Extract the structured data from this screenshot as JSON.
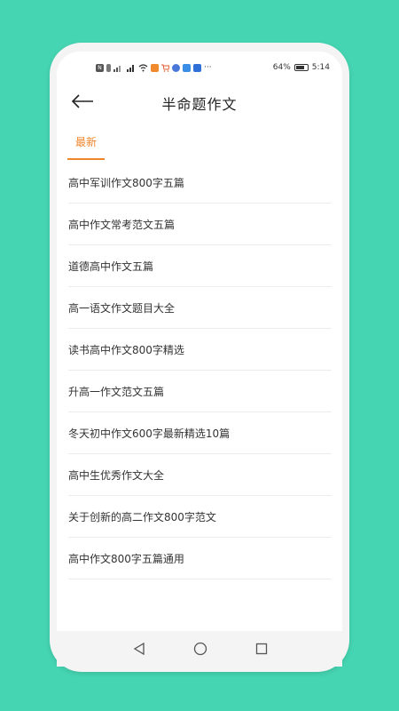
{
  "status_bar": {
    "battery": "64%",
    "battery_level": 0.64,
    "time": "5:14",
    "icons": [
      "nfc-icon",
      "sim-icon",
      "signal-icon",
      "signal-4g-icon",
      "wifi-icon",
      "app-icon-orange",
      "cart-icon",
      "app-icon-blue",
      "app-icon-search",
      "app-icon-bubble",
      "more-icon"
    ]
  },
  "header": {
    "title": "半命题作文"
  },
  "tabs": [
    {
      "label": "最新",
      "active": true
    }
  ],
  "list": [
    {
      "title": "高中军训作文800字五篇"
    },
    {
      "title": "高中作文常考范文五篇"
    },
    {
      "title": "道德高中作文五篇"
    },
    {
      "title": "高一语文作文题目大全"
    },
    {
      "title": "读书高中作文800字精选"
    },
    {
      "title": "升高一作文范文五篇"
    },
    {
      "title": "冬天初中作文600字最新精选10篇"
    },
    {
      "title": "高中生优秀作文大全"
    },
    {
      "title": "关于创新的高二作文800字范文"
    },
    {
      "title": "高中作文800字五篇通用"
    }
  ],
  "colors": {
    "background": "#45d5b2",
    "accent": "#f0862c"
  }
}
